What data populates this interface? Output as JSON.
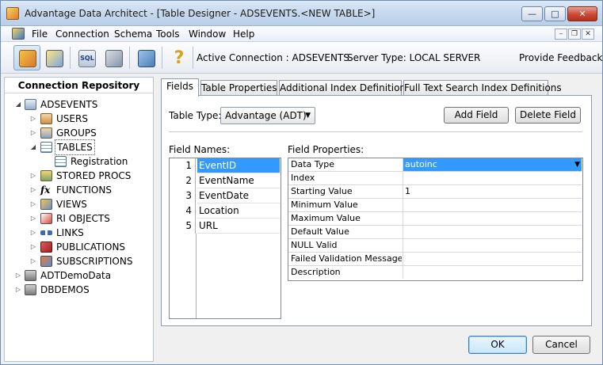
{
  "window": {
    "title": "Advantage Data Architect - [Table Designer - ADSEVENTS.<NEW TABLE>]",
    "minimize_glyph": "—",
    "maximize_glyph": "□",
    "close_glyph": "✕"
  },
  "menu": {
    "items": [
      {
        "label": "File"
      },
      {
        "label": "Connection"
      },
      {
        "label": "Schema"
      },
      {
        "label": "Tools"
      },
      {
        "label": "Window"
      },
      {
        "label": "Help"
      }
    ],
    "mdi_minimize": "–",
    "mdi_restore": "❐",
    "mdi_close": "✕"
  },
  "toolbar": {
    "active_connection": "Active Connection : ADSEVENTS",
    "server_type": "Server Type: LOCAL SERVER",
    "feedback": "Provide Feedback",
    "help_glyph": "?",
    "sql_text": "SQL"
  },
  "repository": {
    "title": "Connection Repository",
    "nodes": [
      {
        "label": "ADSEVENTS",
        "expander": "◢"
      },
      {
        "label": "USERS",
        "expander": "▷"
      },
      {
        "label": "GROUPS",
        "expander": "▷"
      },
      {
        "label": "TABLES",
        "expander": "◢"
      },
      {
        "label": "Registration",
        "expander": ""
      },
      {
        "label": "STORED PROCS",
        "expander": "▷"
      },
      {
        "label": "FUNCTIONS",
        "expander": "▷"
      },
      {
        "label": "VIEWS",
        "expander": "▷"
      },
      {
        "label": "RI OBJECTS",
        "expander": "▷"
      },
      {
        "label": "LINKS",
        "expander": "▷"
      },
      {
        "label": "PUBLICATIONS",
        "expander": "▷"
      },
      {
        "label": "SUBSCRIPTIONS",
        "expander": "▷"
      },
      {
        "label": "ADTDemoData",
        "expander": "▷"
      },
      {
        "label": "DBDEMOS",
        "expander": "▷"
      }
    ]
  },
  "tabs": [
    {
      "label": "Fields"
    },
    {
      "label": "Table Properties"
    },
    {
      "label": "Additional Index Definitions"
    },
    {
      "label": "Full Text Search Index Definitions"
    }
  ],
  "fields_tab": {
    "table_type_label": "Table Type:",
    "table_type_value": "Advantage (ADT)",
    "add_field": "Add Field",
    "delete_field": "Delete Field",
    "field_names_label": "Field Names:",
    "field_properties_label": "Field Properties:",
    "fields": [
      {
        "num": "1",
        "name": "EventID"
      },
      {
        "num": "2",
        "name": "EventName"
      },
      {
        "num": "3",
        "name": "EventDate"
      },
      {
        "num": "4",
        "name": "Location"
      },
      {
        "num": "5",
        "name": "URL"
      }
    ],
    "properties": [
      {
        "name": "Data Type",
        "value": "autoinc"
      },
      {
        "name": "Index",
        "value": ""
      },
      {
        "name": "Starting Value",
        "value": "1"
      },
      {
        "name": "Minimum Value",
        "value": ""
      },
      {
        "name": "Maximum Value",
        "value": ""
      },
      {
        "name": "Default Value",
        "value": ""
      },
      {
        "name": "NULL Valid",
        "value": ""
      },
      {
        "name": "Failed Validation Message",
        "value": ""
      },
      {
        "name": "Description",
        "value": ""
      }
    ]
  },
  "dialog": {
    "ok": "OK",
    "cancel": "Cancel"
  }
}
